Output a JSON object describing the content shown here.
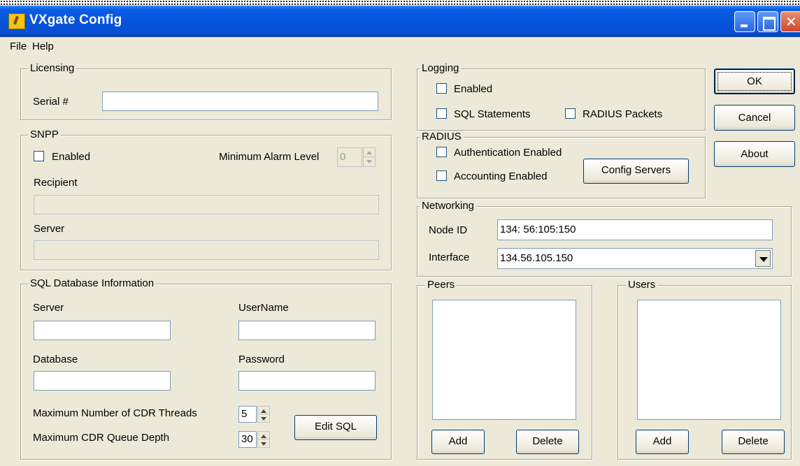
{
  "window": {
    "title": "VXgate Config"
  },
  "menu": {
    "file": "File",
    "help": "Help"
  },
  "licensing": {
    "legend": "Licensing",
    "serial_label": "Serial #",
    "serial_value": ""
  },
  "snpp": {
    "legend": "SNPP",
    "enabled_label": "Enabled",
    "enabled_checked": false,
    "min_alarm_label": "Minimum Alarm Level",
    "min_alarm_value": "0",
    "recipient_label": "Recipient",
    "recipient_value": "",
    "server_label": "Server",
    "server_value": ""
  },
  "sql": {
    "legend": "SQL Database Information",
    "server_label": "Server",
    "server_value": "",
    "username_label": "UserName",
    "username_value": "",
    "database_label": "Database",
    "database_value": "",
    "password_label": "Password",
    "password_value": "",
    "max_threads_label": "Maximum Number of CDR Threads",
    "max_threads_value": "5",
    "max_queue_label": "Maximum CDR Queue Depth",
    "max_queue_value": "30",
    "edit_sql_label": "Edit SQL"
  },
  "logging": {
    "legend": "Logging",
    "enabled_label": "Enabled",
    "sql_statements_label": "SQL Statements",
    "radius_packets_label": "RADIUS Packets"
  },
  "radius": {
    "legend": "RADIUS",
    "auth_label": "Authentication Enabled",
    "acct_label": "Accounting Enabled",
    "config_servers_label": "Config Servers"
  },
  "networking": {
    "legend": "Networking",
    "node_id_label": "Node ID",
    "node_id_value": "134: 56:105:150",
    "interface_label": "Interface",
    "interface_value": "134.56.105.150"
  },
  "peers": {
    "legend": "Peers",
    "add_label": "Add",
    "delete_label": "Delete"
  },
  "users": {
    "legend": "Users",
    "add_label": "Add",
    "delete_label": "Delete"
  },
  "buttons": {
    "ok": "OK",
    "cancel": "Cancel",
    "about": "About"
  }
}
